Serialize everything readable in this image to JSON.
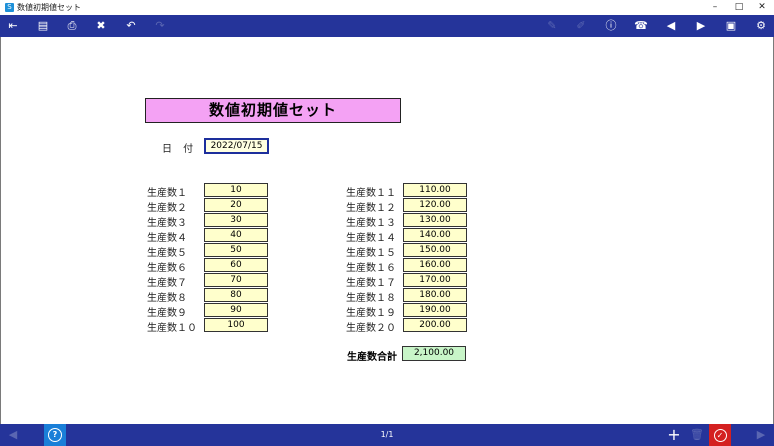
{
  "window": {
    "title": "数値初期値セット",
    "app_icon": "S"
  },
  "form": {
    "heading": "数値初期値セット",
    "date_label": "日 付",
    "date_value": "2022/07/15",
    "left": [
      {
        "label": "生産数１",
        "value": "10"
      },
      {
        "label": "生産数２",
        "value": "20"
      },
      {
        "label": "生産数３",
        "value": "30"
      },
      {
        "label": "生産数４",
        "value": "40"
      },
      {
        "label": "生産数５",
        "value": "50"
      },
      {
        "label": "生産数６",
        "value": "60"
      },
      {
        "label": "生産数７",
        "value": "70"
      },
      {
        "label": "生産数８",
        "value": "80"
      },
      {
        "label": "生産数９",
        "value": "90"
      },
      {
        "label": "生産数１０",
        "value": "100"
      }
    ],
    "right": [
      {
        "label": "生産数１１",
        "value": "110.00"
      },
      {
        "label": "生産数１２",
        "value": "120.00"
      },
      {
        "label": "生産数１３",
        "value": "130.00"
      },
      {
        "label": "生産数１４",
        "value": "140.00"
      },
      {
        "label": "生産数１５",
        "value": "150.00"
      },
      {
        "label": "生産数１６",
        "value": "160.00"
      },
      {
        "label": "生産数１７",
        "value": "170.00"
      },
      {
        "label": "生産数１８",
        "value": "180.00"
      },
      {
        "label": "生産数１９",
        "value": "190.00"
      },
      {
        "label": "生産数２０",
        "value": "200.00"
      }
    ],
    "total_label": "生産数合計",
    "total_value": "2,100.00"
  },
  "footer": {
    "page_indicator": "1/1"
  },
  "colors": {
    "bar": "#25349a",
    "heading_bg": "#f4a2f4",
    "field_bg": "#ffffcc",
    "total_bg": "#c8f5c8",
    "help": "#1a7fd8",
    "ok": "#d42020"
  }
}
